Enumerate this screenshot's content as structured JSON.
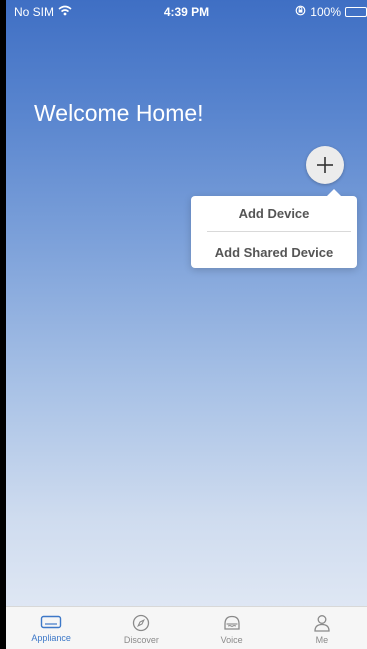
{
  "status_bar": {
    "carrier": "No SIM",
    "time": "4:39 PM",
    "battery": "100%",
    "battery_level": 1.0
  },
  "home": {
    "welcome_title": "Welcome Home!"
  },
  "add_menu": {
    "items": [
      {
        "label": "Add Device"
      },
      {
        "label": "Add Shared Device"
      }
    ]
  },
  "tab_bar": {
    "active_tab": "Appliance",
    "accent_color": "#3d78c8",
    "tabs": [
      {
        "label": "Appliance",
        "icon": "appliance-icon"
      },
      {
        "label": "Discover",
        "icon": "compass-icon"
      },
      {
        "label": "Voice",
        "icon": "speaker-icon"
      },
      {
        "label": "Me",
        "icon": "person-icon"
      }
    ]
  }
}
